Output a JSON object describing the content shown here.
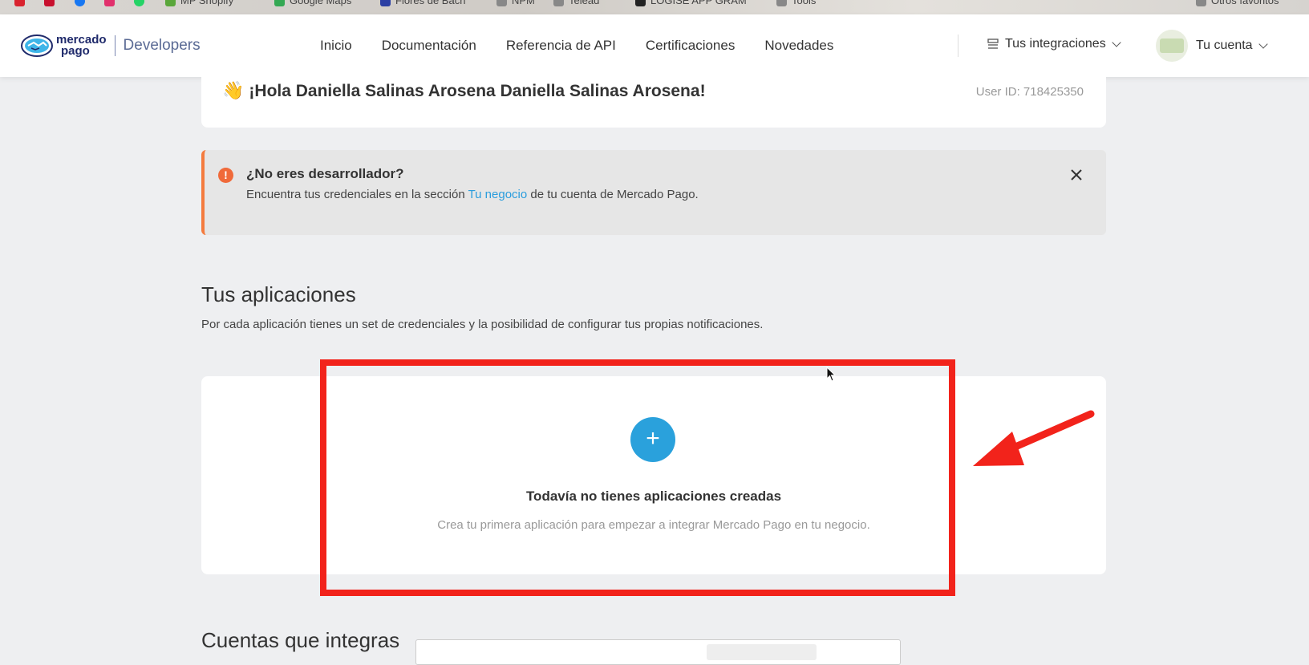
{
  "bookmarks": [
    {
      "label": "MP Shopify",
      "color": "#5aa63a"
    },
    {
      "label": "Google Maps",
      "color": "#34a853"
    },
    {
      "label": "Flores de Bach",
      "color": "#2b3fa3"
    },
    {
      "label": "NPM",
      "color": "#888888"
    },
    {
      "label": "Telead",
      "color": "#888888"
    },
    {
      "label": "LOGISE APP GRAM",
      "color": "#222222"
    },
    {
      "label": "Tools",
      "color": "#888888"
    }
  ],
  "bookmarks_right": "Otros favoritos",
  "header": {
    "logo": {
      "line1": "mercado",
      "line2": "pago",
      "product": "Developers"
    },
    "nav": [
      "Inicio",
      "Documentación",
      "Referencia de API",
      "Certificaciones",
      "Novedades"
    ],
    "integrations_label": "Tus integraciones",
    "account_label": "Tu cuenta"
  },
  "greeting": {
    "emoji": "👋",
    "text": "¡Hola Daniella Salinas Arosena Daniella Salinas Arosena!",
    "user_id": "User ID: 718425350"
  },
  "notice": {
    "title": "¿No eres desarrollador?",
    "body_before": "Encuentra tus credenciales en la sección ",
    "body_link": "Tu negocio",
    "body_after": " de tu cuenta de Mercado Pago.",
    "accent_color": "#f47b3e"
  },
  "apps": {
    "title": "Tus aplicaciones",
    "description": "Por cada aplicación tienes un set de credenciales y la posibilidad de configurar tus propias notificaciones.",
    "empty_title": "Todavía no tienes aplicaciones creadas",
    "empty_description": "Crea tu primera aplicación para empezar a integrar Mercado Pago en tu negocio.",
    "add_icon": "plus-icon",
    "accent_color": "#2aa1dc"
  },
  "section2": {
    "title": "Cuentas que integras"
  },
  "annotation": {
    "highlight_color": "#f2231b"
  }
}
